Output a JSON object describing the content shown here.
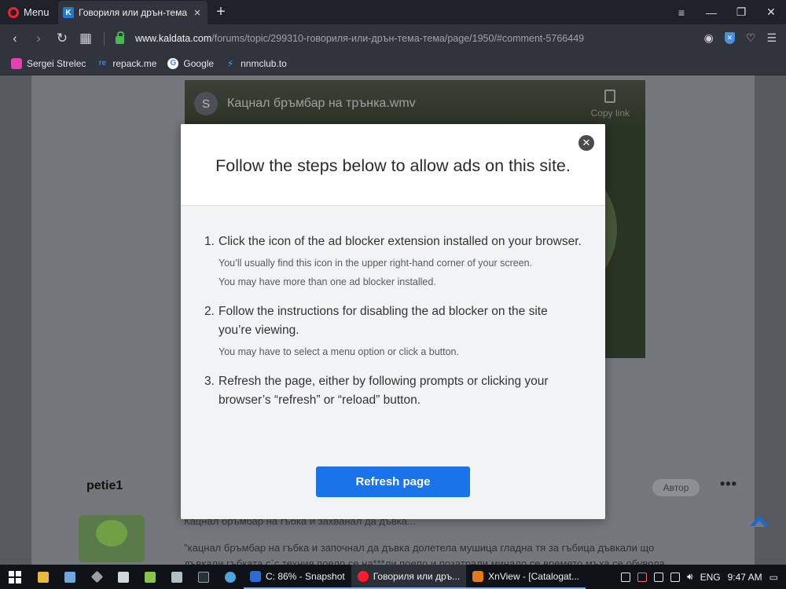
{
  "browser": {
    "menu_label": "Menu",
    "tab": {
      "title": "Говориля или дрън-тема",
      "favicon": "K"
    },
    "url_host": "www.kaldata.com",
    "url_path": "/forums/topic/299310-говориля-или-дрън-тема-тема/page/1950/#comment-5766449",
    "bookmarks": [
      {
        "label": "Sergei Strelec",
        "icon": "pink-square-icon"
      },
      {
        "label": "repack.me",
        "icon": "re"
      },
      {
        "label": "Google",
        "icon": "G"
      },
      {
        "label": "nnmclub.to",
        "icon": "nnm-icon"
      }
    ]
  },
  "page": {
    "video": {
      "avatar_letter": "S",
      "title": "Кацнал бръмбар на трънка.wmv",
      "copy_link": "Copy link"
    },
    "post": {
      "username": "petie1",
      "author_badge": "Автор",
      "line1": "Кацнал бръмбар на гъбка и захванал да дъвка...",
      "line2": "\"кацнал бръмбар на гъбка и започнал да дъвка долетела мушица гладна тя за гъбица дъвкали що",
      "line3": "дъвкали гъбката с`с техния поело се на***ли поело и позатрали минало се времето мъха се обувола"
    }
  },
  "modal": {
    "title": "Follow the steps below to allow ads on this site.",
    "steps": [
      {
        "num": "1.",
        "text": "Click the icon of the ad blocker extension installed on your browser.",
        "sub1": "You’ll usually find this icon in the upper right-hand corner of your screen.",
        "sub2": "You may have more than one ad blocker installed."
      },
      {
        "num": "2.",
        "text": "Follow the instructions for disabling the ad blocker on the site you’re viewing.",
        "sub1": "You may have to select a menu option or click a button."
      },
      {
        "num": "3.",
        "text": "Refresh the page, either by following prompts or clicking your browser’s “refresh” or “reload” button."
      }
    ],
    "button_label": "Refresh page",
    "accent_color": "#1a73e8"
  },
  "taskbar": {
    "tasks": [
      {
        "label": "C: 86% - Snapshot",
        "color": "#2e6bd6"
      },
      {
        "label": "Говориля или дръ...",
        "color": "#ff1b2d"
      },
      {
        "label": "XnView - [Catalogat...",
        "color": "#e07a1a"
      }
    ],
    "language": "ENG",
    "clock": "9:47 AM"
  }
}
